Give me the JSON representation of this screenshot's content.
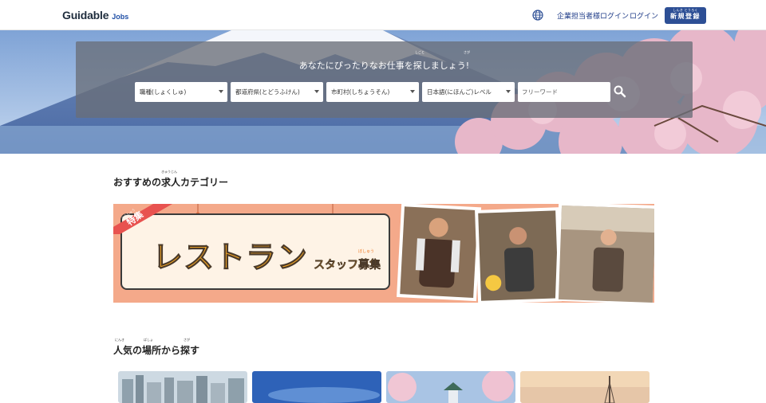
{
  "header": {
    "logo_main": "Guidable",
    "logo_sub": "Jobs",
    "employer_login": "企業担当者様ログイン",
    "login": "ログイン",
    "signup_ruby": "しんき とうろく",
    "signup_label": "新規登録"
  },
  "search": {
    "title": "あなたにぴったりなお仕事を探しましょう!",
    "title_ruby_shigoto": "しごと",
    "title_ruby_sagasu": "さが",
    "occupation": "職種(しょくしゅ)",
    "prefecture": "都道府県(とどうふけん)",
    "city": "市町村(しちょうそん)",
    "japanese_level": "日本語(にほんご)レベル",
    "freeword_placeholder": "フリーワード"
  },
  "recommended": {
    "title": "おすすめの求人カテゴリー",
    "title_ruby": "きゅうじん",
    "banner": {
      "badge": "特集",
      "badge_ruby": "とくしゅう",
      "main": "レストラン",
      "sub": "スタッフ募集",
      "sub_ruby": "ぼしゅう"
    }
  },
  "popular_locations": {
    "title": "人気の場所から探す",
    "ruby_ninki": "にんき",
    "ruby_basho": "ばしょ",
    "ruby_sagasu": "さが"
  },
  "colors": {
    "brand_navy": "#2d4f95",
    "banner_bg": "#f4a98a",
    "banner_text": "#f5a623"
  }
}
